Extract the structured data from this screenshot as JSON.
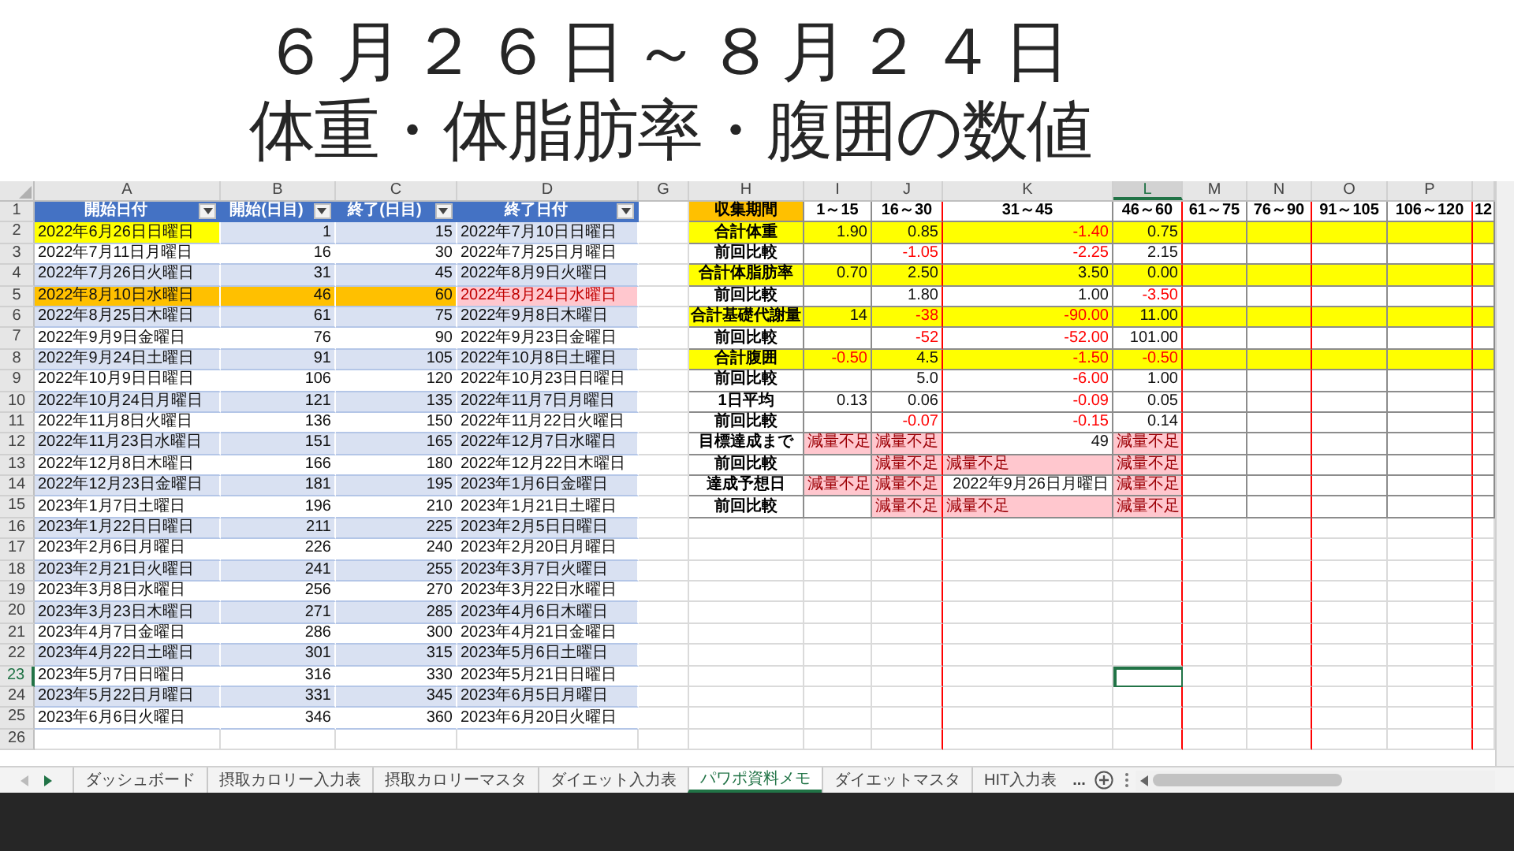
{
  "title": {
    "lines": [
      "６月２６日～８月２４日",
      "体重・体脂肪率・腹囲の数値"
    ]
  },
  "columns": [
    {
      "letter": "A",
      "selected": false
    },
    {
      "letter": "B",
      "selected": false
    },
    {
      "letter": "C",
      "selected": false
    },
    {
      "letter": "D",
      "selected": false
    },
    {
      "letter": "G",
      "selected": false
    },
    {
      "letter": "H",
      "selected": false
    },
    {
      "letter": "I",
      "selected": false
    },
    {
      "letter": "J",
      "selected": false
    },
    {
      "letter": "K",
      "selected": false
    },
    {
      "letter": "L",
      "selected": true
    },
    {
      "letter": "M",
      "selected": false
    },
    {
      "letter": "N",
      "selected": false
    },
    {
      "letter": "O",
      "selected": false
    },
    {
      "letter": "P",
      "selected": false
    }
  ],
  "row_headers": [
    {
      "label": "1",
      "selected": false
    },
    {
      "label": "2",
      "selected": false
    },
    {
      "label": "3",
      "selected": false
    },
    {
      "label": "4",
      "selected": false
    },
    {
      "label": "5",
      "selected": false
    },
    {
      "label": "6",
      "selected": false
    },
    {
      "label": "7",
      "selected": false
    },
    {
      "label": "8",
      "selected": false
    },
    {
      "label": "9",
      "selected": false
    },
    {
      "label": "10",
      "selected": false
    },
    {
      "label": "11",
      "selected": false
    },
    {
      "label": "12",
      "selected": false
    },
    {
      "label": "13",
      "selected": false
    },
    {
      "label": "14",
      "selected": false
    },
    {
      "label": "15",
      "selected": false
    },
    {
      "label": "16",
      "selected": false
    },
    {
      "label": "17",
      "selected": false
    },
    {
      "label": "18",
      "selected": false
    },
    {
      "label": "19",
      "selected": false
    },
    {
      "label": "20",
      "selected": false
    },
    {
      "label": "21",
      "selected": false
    },
    {
      "label": "22",
      "selected": false
    },
    {
      "label": "23",
      "selected": true
    },
    {
      "label": "24",
      "selected": false
    },
    {
      "label": "25",
      "selected": false
    },
    {
      "label": "26",
      "selected": false
    }
  ],
  "left_table": {
    "headers": [
      "開始日付",
      "開始(日目)",
      "終了(日目)",
      "終了日付"
    ],
    "rows": [
      {
        "start": "2022年6月26日日曜日",
        "start_day": "1",
        "end_day": "15",
        "end": "2022年7月10日日曜日",
        "marked": true,
        "current": false
      },
      {
        "start": "2022年7月11日月曜日",
        "start_day": "16",
        "end_day": "30",
        "end": "2022年7月25日月曜日",
        "marked": false,
        "current": false
      },
      {
        "start": "2022年7月26日火曜日",
        "start_day": "31",
        "end_day": "45",
        "end": "2022年8月9日火曜日",
        "marked": false,
        "current": false
      },
      {
        "start": "2022年8月10日水曜日",
        "start_day": "46",
        "end_day": "60",
        "end": "2022年8月24日水曜日",
        "marked": false,
        "current": true
      },
      {
        "start": "2022年8月25日木曜日",
        "start_day": "61",
        "end_day": "75",
        "end": "2022年9月8日木曜日",
        "marked": false,
        "current": false
      },
      {
        "start": "2022年9月9日金曜日",
        "start_day": "76",
        "end_day": "90",
        "end": "2022年9月23日金曜日",
        "marked": false,
        "current": false
      },
      {
        "start": "2022年9月24日土曜日",
        "start_day": "91",
        "end_day": "105",
        "end": "2022年10月8日土曜日",
        "marked": false,
        "current": false
      },
      {
        "start": "2022年10月9日日曜日",
        "start_day": "106",
        "end_day": "120",
        "end": "2022年10月23日日曜日",
        "marked": false,
        "current": false
      },
      {
        "start": "2022年10月24日月曜日",
        "start_day": "121",
        "end_day": "135",
        "end": "2022年11月7日月曜日",
        "marked": false,
        "current": false
      },
      {
        "start": "2022年11月8日火曜日",
        "start_day": "136",
        "end_day": "150",
        "end": "2022年11月22日火曜日",
        "marked": false,
        "current": false
      },
      {
        "start": "2022年11月23日水曜日",
        "start_day": "151",
        "end_day": "165",
        "end": "2022年12月7日水曜日",
        "marked": false,
        "current": false
      },
      {
        "start": "2022年12月8日木曜日",
        "start_day": "166",
        "end_day": "180",
        "end": "2022年12月22日木曜日",
        "marked": false,
        "current": false
      },
      {
        "start": "2022年12月23日金曜日",
        "start_day": "181",
        "end_day": "195",
        "end": "2023年1月6日金曜日",
        "marked": false,
        "current": false
      },
      {
        "start": "2023年1月7日土曜日",
        "start_day": "196",
        "end_day": "210",
        "end": "2023年1月21日土曜日",
        "marked": false,
        "current": false
      },
      {
        "start": "2023年1月22日日曜日",
        "start_day": "211",
        "end_day": "225",
        "end": "2023年2月5日日曜日",
        "marked": false,
        "current": false
      },
      {
        "start": "2023年2月6日月曜日",
        "start_day": "226",
        "end_day": "240",
        "end": "2023年2月20日月曜日",
        "marked": false,
        "current": false
      },
      {
        "start": "2023年2月21日火曜日",
        "start_day": "241",
        "end_day": "255",
        "end": "2023年3月7日火曜日",
        "marked": false,
        "current": false
      },
      {
        "start": "2023年3月8日水曜日",
        "start_day": "256",
        "end_day": "270",
        "end": "2023年3月22日水曜日",
        "marked": false,
        "current": false
      },
      {
        "start": "2023年3月23日木曜日",
        "start_day": "271",
        "end_day": "285",
        "end": "2023年4月6日木曜日",
        "marked": false,
        "current": false
      },
      {
        "start": "2023年4月7日金曜日",
        "start_day": "286",
        "end_day": "300",
        "end": "2023年4月21日金曜日",
        "marked": false,
        "current": false
      },
      {
        "start": "2023年4月22日土曜日",
        "start_day": "301",
        "end_day": "315",
        "end": "2023年5月6日土曜日",
        "marked": false,
        "current": false
      },
      {
        "start": "2023年5月7日日曜日",
        "start_day": "316",
        "end_day": "330",
        "end": "2023年5月21日日曜日",
        "marked": false,
        "current": false
      },
      {
        "start": "2023年5月22日月曜日",
        "start_day": "331",
        "end_day": "345",
        "end": "2023年6月5日月曜日",
        "marked": false,
        "current": false
      },
      {
        "start": "2023年6月6日火曜日",
        "start_day": "346",
        "end_day": "360",
        "end": "2023年6月20日火曜日",
        "marked": false,
        "current": false
      }
    ]
  },
  "right_table": {
    "header_label": "収集期間",
    "periods": [
      "1～15",
      "16～30",
      "31～45",
      "46～60",
      "61～75",
      "76～90",
      "91～105",
      "106～120",
      "12"
    ],
    "rows": [
      {
        "label": "合計体重",
        "highlighted": true,
        "cells": [
          {
            "text": "1.90",
            "negative": false,
            "shortfall": false
          },
          {
            "text": "0.85",
            "negative": false,
            "shortfall": false
          },
          {
            "text": "-1.40",
            "negative": true,
            "shortfall": false
          },
          {
            "text": "0.75",
            "negative": false,
            "shortfall": false
          }
        ]
      },
      {
        "label": "前回比較",
        "highlighted": false,
        "cells": [
          {
            "negative": false,
            "shortfall": false
          },
          {
            "text": "-1.05",
            "negative": true,
            "shortfall": false
          },
          {
            "text": "-2.25",
            "negative": true,
            "shortfall": false
          },
          {
            "text": "2.15",
            "negative": false,
            "shortfall": false
          }
        ]
      },
      {
        "label": "合計体脂肪率",
        "highlighted": true,
        "cells": [
          {
            "text": "0.70",
            "negative": false,
            "shortfall": false
          },
          {
            "text": "2.50",
            "negative": false,
            "shortfall": false
          },
          {
            "text": "3.50",
            "negative": false,
            "shortfall": false
          },
          {
            "text": "0.00",
            "negative": false,
            "shortfall": false
          }
        ]
      },
      {
        "label": "前回比較",
        "highlighted": false,
        "cells": [
          {
            "negative": false,
            "shortfall": false
          },
          {
            "text": "1.80",
            "negative": false,
            "shortfall": false
          },
          {
            "text": "1.00",
            "negative": false,
            "shortfall": false
          },
          {
            "text": "-3.50",
            "negative": true,
            "shortfall": false
          }
        ]
      },
      {
        "label": "合計基礎代謝量",
        "highlighted": true,
        "cells": [
          {
            "text": "14",
            "negative": false,
            "shortfall": false
          },
          {
            "text": "-38",
            "negative": true,
            "shortfall": false
          },
          {
            "text": "-90.00",
            "negative": true,
            "shortfall": false
          },
          {
            "text": "11.00",
            "negative": false,
            "shortfall": false
          }
        ]
      },
      {
        "label": "前回比較",
        "highlighted": false,
        "cells": [
          {
            "negative": false,
            "shortfall": false
          },
          {
            "text": "-52",
            "negative": true,
            "shortfall": false
          },
          {
            "text": "-52.00",
            "negative": true,
            "shortfall": false
          },
          {
            "text": "101.00",
            "negative": false,
            "shortfall": false
          }
        ]
      },
      {
        "label": "合計腹囲",
        "highlighted": true,
        "cells": [
          {
            "text": "-0.50",
            "negative": true,
            "shortfall": false
          },
          {
            "text": "4.5",
            "negative": false,
            "shortfall": false
          },
          {
            "text": "-1.50",
            "negative": true,
            "shortfall": false
          },
          {
            "text": "-0.50",
            "negative": true,
            "shortfall": false
          }
        ]
      },
      {
        "label": "前回比較",
        "highlighted": false,
        "cells": [
          {
            "negative": false,
            "shortfall": false
          },
          {
            "text": "5.0",
            "negative": false,
            "shortfall": false
          },
          {
            "text": "-6.00",
            "negative": true,
            "shortfall": false
          },
          {
            "text": "1.00",
            "negative": false,
            "shortfall": false
          }
        ]
      },
      {
        "label": "1日平均",
        "highlighted": false,
        "cells": [
          {
            "text": "0.13",
            "negative": false,
            "shortfall": false
          },
          {
            "text": "0.06",
            "negative": false,
            "shortfall": false
          },
          {
            "text": "-0.09",
            "negative": true,
            "shortfall": false
          },
          {
            "text": "0.05",
            "negative": false,
            "shortfall": false
          }
        ]
      },
      {
        "label": "前回比較",
        "highlighted": false,
        "cells": [
          {
            "negative": false,
            "shortfall": false
          },
          {
            "text": "-0.07",
            "negative": true,
            "shortfall": false
          },
          {
            "text": "-0.15",
            "negative": true,
            "shortfall": false
          },
          {
            "text": "0.14",
            "negative": false,
            "shortfall": false
          }
        ]
      },
      {
        "label": "目標達成まで",
        "highlighted": false,
        "cells": [
          {
            "text": "減量不足",
            "negative": false,
            "shortfall": true
          },
          {
            "text": "減量不足",
            "negative": false,
            "shortfall": true
          },
          {
            "text": "49",
            "negative": false,
            "shortfall": false
          },
          {
            "text": "減量不足",
            "negative": false,
            "shortfall": true
          }
        ]
      },
      {
        "label": "前回比較",
        "highlighted": false,
        "cells": [
          {
            "negative": false,
            "shortfall": false
          },
          {
            "text": "減量不足",
            "negative": false,
            "shortfall": true
          },
          {
            "text": "減量不足",
            "negative": false,
            "shortfall": true
          },
          {
            "text": "減量不足",
            "negative": false,
            "shortfall": true
          }
        ]
      },
      {
        "label": "達成予想日",
        "highlighted": false,
        "cells": [
          {
            "text": "減量不足",
            "negative": false,
            "shortfall": true
          },
          {
            "text": "減量不足",
            "negative": false,
            "shortfall": true
          },
          {
            "text": "2022年9月26日月曜日",
            "negative": false,
            "shortfall": false
          },
          {
            "text": "減量不足",
            "negative": false,
            "shortfall": true
          }
        ]
      },
      {
        "label": "前回比較",
        "highlighted": false,
        "cells": [
          {
            "negative": false,
            "shortfall": false
          },
          {
            "text": "減量不足",
            "negative": false,
            "shortfall": true
          },
          {
            "text": "減量不足",
            "negative": false,
            "shortfall": true
          },
          {
            "text": "減量不足",
            "negative": false,
            "shortfall": true
          }
        ]
      }
    ]
  },
  "sheet_tabs": [
    {
      "label": "ダッシュボード",
      "selected": false
    },
    {
      "label": "摂取カロリー入力表",
      "selected": false
    },
    {
      "label": "摂取カロリーマスタ",
      "selected": false
    },
    {
      "label": "ダイエット入力表",
      "selected": false
    },
    {
      "label": "パワポ資料メモ",
      "selected": true
    },
    {
      "label": "ダイエットマスタ",
      "selected": false
    },
    {
      "label": "HIT入力表",
      "selected": false
    }
  ],
  "tabs_overflow": "..."
}
